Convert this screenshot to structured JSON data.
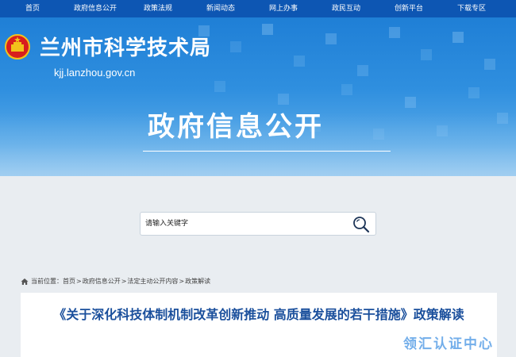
{
  "nav": {
    "items": [
      "首页",
      "政府信息公开",
      "政策法规",
      "新闻动态",
      "网上办事",
      "政民互动",
      "创新平台",
      "下载专区"
    ]
  },
  "header": {
    "site_title": "兰州市科学技术局",
    "domain": "kjj.lanzhou.gov.cn",
    "section_title": "政府信息公开"
  },
  "search": {
    "placeholder": "请输入关键字",
    "icon": "search-icon"
  },
  "breadcrumb": {
    "prefix": "当前位置：",
    "items": [
      "首页",
      "政府信息公开",
      "法定主动公开内容",
      "政策解读"
    ],
    "separator": ">"
  },
  "article": {
    "title": "《关于深化科技体制机制改革创新推动 高质量发展的若干措施》政策解读"
  },
  "watermark": {
    "text": "领汇认证中心"
  },
  "colors": {
    "nav_bg": "#0d56b3",
    "banner_top": "#1f7fd6",
    "title_blue": "#1a4f9c",
    "page_bg": "#e9edf1"
  }
}
